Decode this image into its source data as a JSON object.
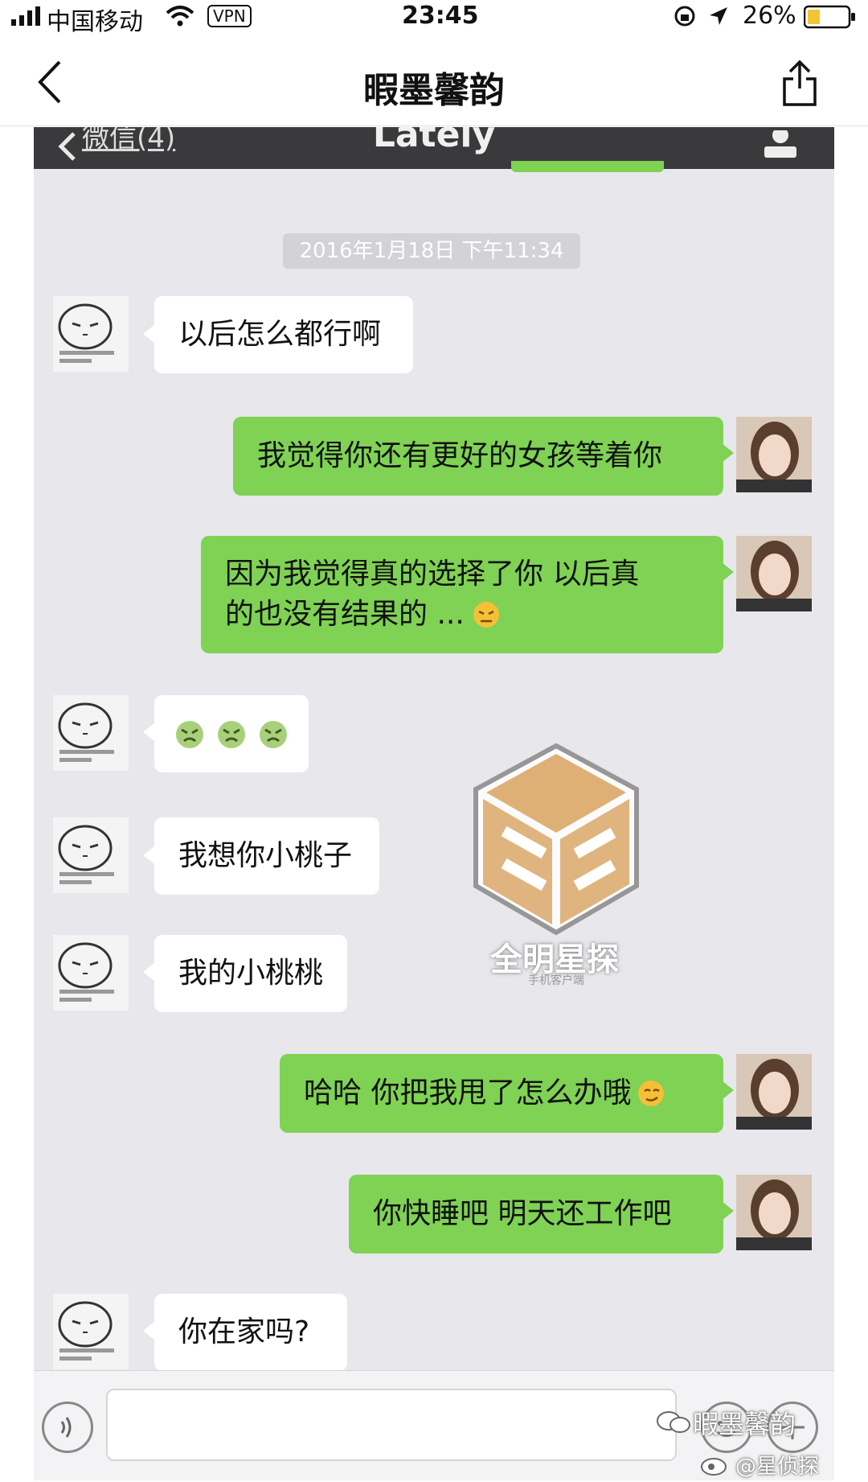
{
  "status_bar": {
    "carrier": "中国移动",
    "vpn": "VPN",
    "time": "23:45",
    "battery": "26%"
  },
  "header": {
    "title": "暇墨馨韵"
  },
  "chat_screenshot": {
    "nav": {
      "back_label": "微信(4)",
      "title": "Lately"
    },
    "timestamp": "2016年1月18日 下午11:34",
    "messages": [
      {
        "side": "in",
        "text": "以后怎么都行啊"
      },
      {
        "side": "out",
        "text": "我觉得你还有更好的女孩等着你"
      },
      {
        "side": "out",
        "text_line1": "因为我觉得真的选择了你 以后真",
        "text_line2": "的也没有结果的 ..."
      },
      {
        "side": "in",
        "text": ""
      },
      {
        "side": "in",
        "text": "我想你小桃子"
      },
      {
        "side": "in",
        "text": "我的小桃桃"
      },
      {
        "side": "out",
        "text": "哈哈 你把我甩了怎么办哦"
      },
      {
        "side": "out",
        "text": "你快睡吧 明天还工作吧"
      },
      {
        "side": "in",
        "text": "你在家吗?"
      }
    ]
  },
  "watermark": {
    "label": "全明星探",
    "sub": "手机客户端",
    "footer_line1": "暇墨馨韵",
    "footer_line2": "@星侦探"
  },
  "colors": {
    "outgoing_bubble": "#7fd254",
    "incoming_bubble": "#ffffff",
    "chat_background": "#e8e7ec"
  }
}
